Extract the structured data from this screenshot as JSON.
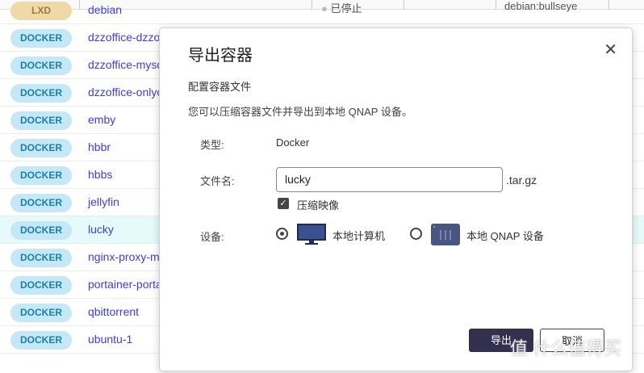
{
  "rows": [
    {
      "type": "LXD",
      "name": "debian",
      "status": "已停止",
      "image": "debian:bullseye"
    },
    {
      "type": "DOCKER",
      "name": "dzzoffice-dzzoffice"
    },
    {
      "type": "DOCKER",
      "name": "dzzoffice-mysql"
    },
    {
      "type": "DOCKER",
      "name": "dzzoffice-onlyoffice"
    },
    {
      "type": "DOCKER",
      "name": "emby"
    },
    {
      "type": "DOCKER",
      "name": "hbbr"
    },
    {
      "type": "DOCKER",
      "name": "hbbs"
    },
    {
      "type": "DOCKER",
      "name": "jellyfin"
    },
    {
      "type": "DOCKER",
      "name": "lucky",
      "selected": true
    },
    {
      "type": "DOCKER",
      "name": "nginx-proxy-manager"
    },
    {
      "type": "DOCKER",
      "name": "portainer-portainer"
    },
    {
      "type": "DOCKER",
      "name": "qbittorrent"
    },
    {
      "type": "DOCKER",
      "name": "ubuntu-1"
    }
  ],
  "dialog": {
    "title": "导出容器",
    "subtitle": "配置容器文件",
    "description": "您可以压缩容器文件并导出到本地 QNAP 设备。",
    "type_label": "类型:",
    "type_value": "Docker",
    "filename_label": "文件名:",
    "filename_value": "lucky",
    "filename_ext": ".tar.gz",
    "compress_label": "压缩映像",
    "compress_checked": true,
    "device_label": "设备:",
    "device_options": [
      "本地计算机",
      "本地 QNAP 设备"
    ],
    "device_selected": 0,
    "export_label": "导出",
    "cancel_label": "取消"
  },
  "watermark": "值 什么值得买"
}
